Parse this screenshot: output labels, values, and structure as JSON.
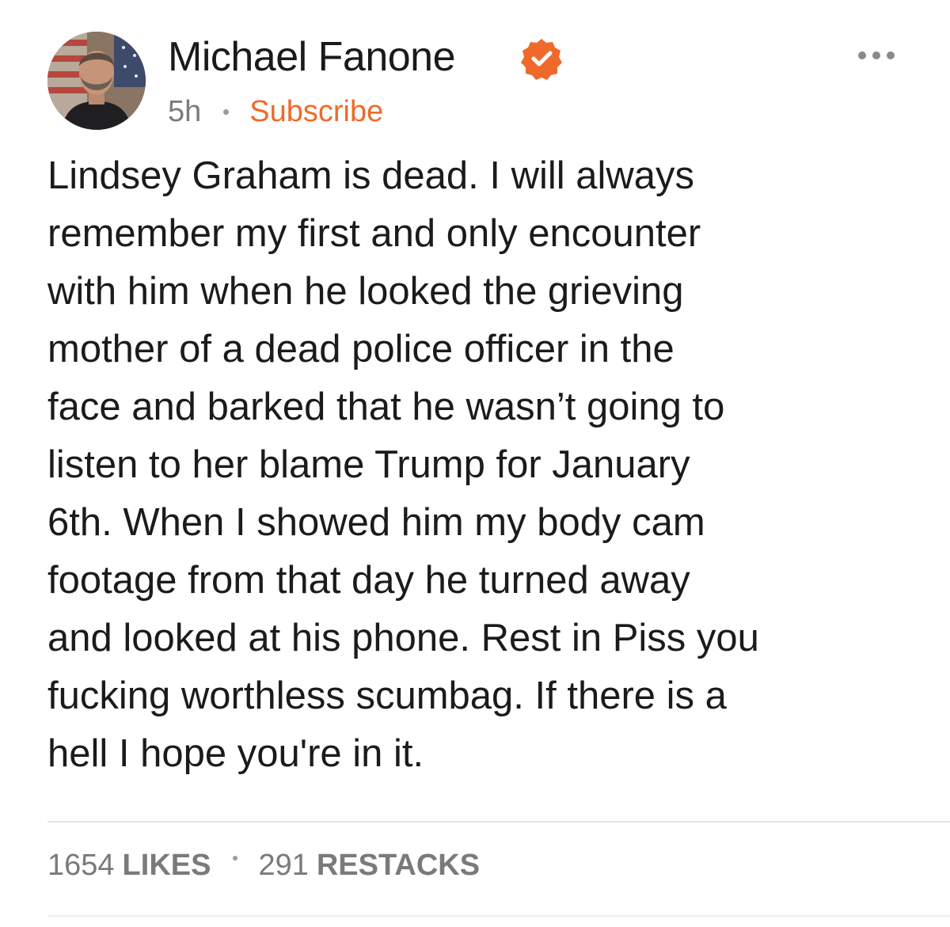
{
  "post": {
    "author": {
      "name": "Michael Fanone",
      "verified": true,
      "badge_color": "#ef6a2a"
    },
    "timestamp": "5h",
    "subscribe_label": "Subscribe",
    "accent_color": "#ef6a2a",
    "body_lines": [
      "Lindsey Graham is dead. I will always",
      "remember my first and only encounter",
      "with him when he looked the grieving",
      "mother of a dead police officer in the",
      "face and barked that he wasn’t going to",
      "listen to her blame Trump for January",
      "6th. When I showed him my body cam",
      "footage from that day he turned away",
      "and looked at his phone. Rest in Piss you",
      "fucking worthless scumbag. If there is a",
      "hell I hope you're in it."
    ],
    "stats": {
      "likes_count": "1654",
      "likes_label": "LIKES",
      "restacks_count": "291",
      "restacks_label": "RESTACKS"
    },
    "icons": {
      "more": "more-horizontal-icon",
      "verified": "verified-check-icon"
    }
  }
}
